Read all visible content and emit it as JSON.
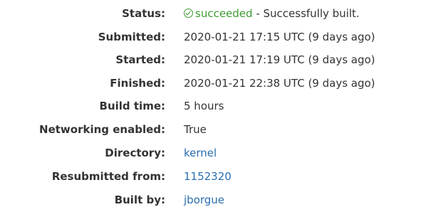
{
  "build": {
    "status": {
      "label": "Status:",
      "state": "succeeded",
      "separator": " - ",
      "message": "Successfully built.",
      "icon": "check-circle-icon",
      "state_color": "#3f9c35"
    },
    "submitted": {
      "label": "Submitted:",
      "value": "2020-01-21 17:15 UTC (9 days ago)"
    },
    "started": {
      "label": "Started:",
      "value": "2020-01-21 17:19 UTC (9 days ago)"
    },
    "finished": {
      "label": "Finished:",
      "value": "2020-01-21 22:38 UTC (9 days ago)"
    },
    "build_time": {
      "label": "Build time:",
      "value": "5 hours"
    },
    "networking": {
      "label": "Networking enabled:",
      "value": "True"
    },
    "directory": {
      "label": "Directory:",
      "value": "kernel"
    },
    "resubmitted_from": {
      "label": "Resubmitted from:",
      "value": "1152320"
    },
    "built_by": {
      "label": "Built by:",
      "value": "jborgue"
    },
    "link_color": "#2a6eb0"
  }
}
